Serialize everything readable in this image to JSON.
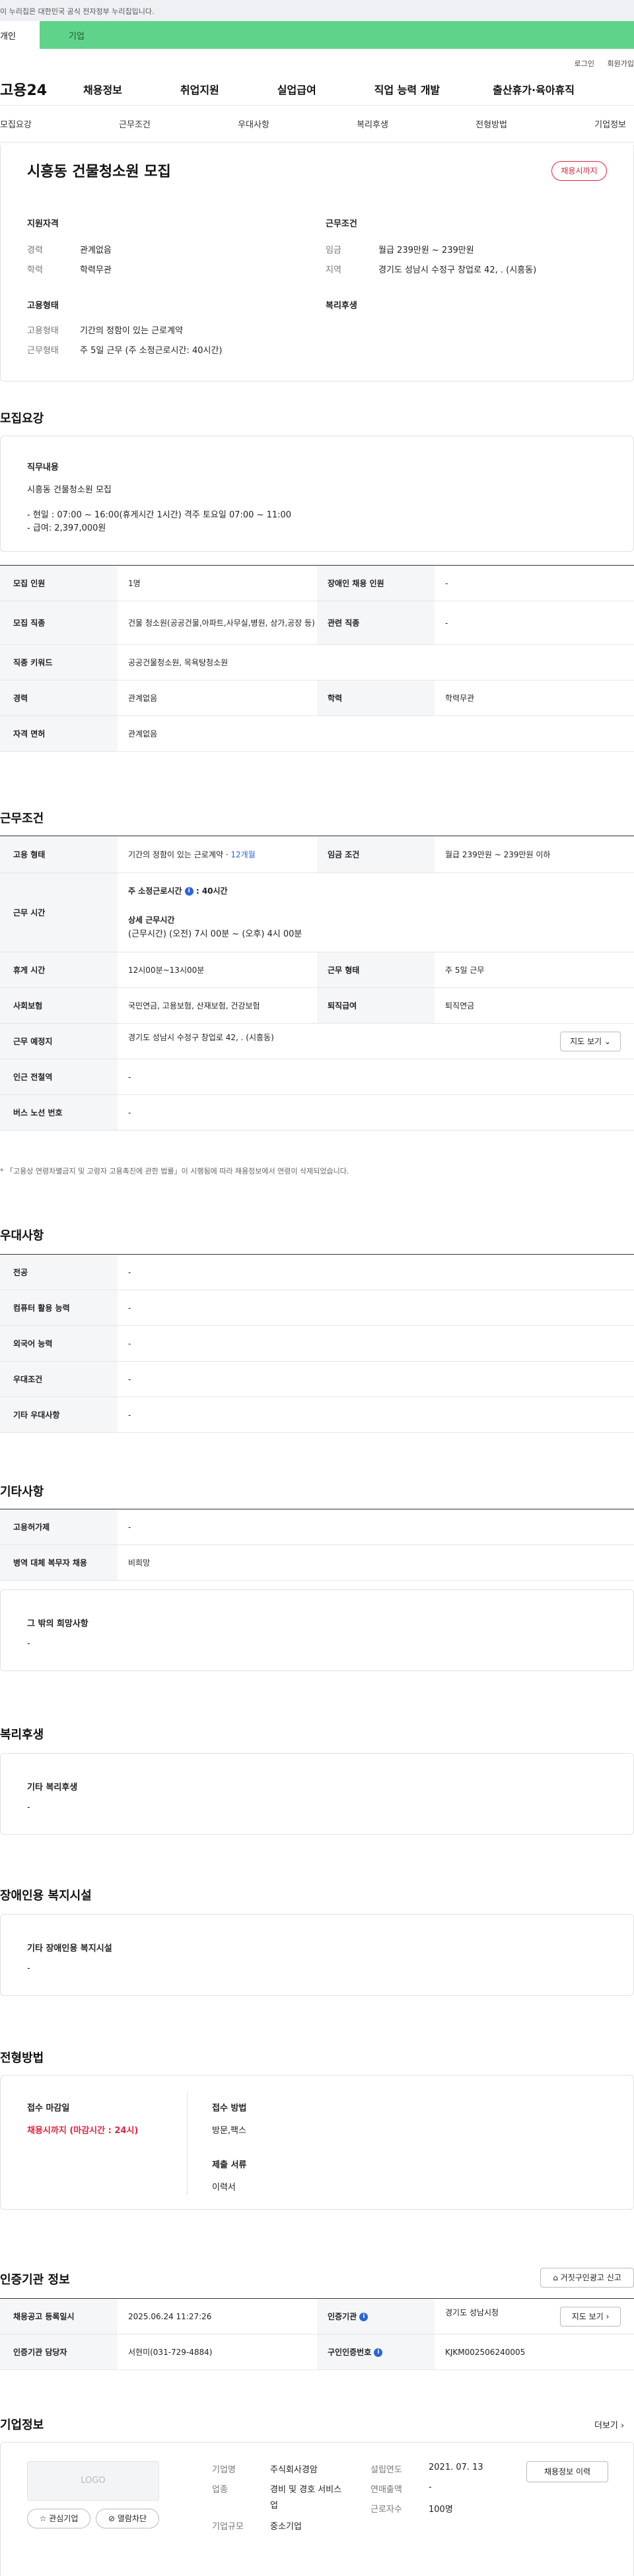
{
  "gov_banner": "이 누리집은 대한민국 공식 전자정부 누리집입니다.",
  "user_tabs": [
    "개인",
    "기업"
  ],
  "util_links": [
    "로그인",
    "회원가입"
  ],
  "brand": "고용24",
  "gnb": [
    "채용정보",
    "취업지원",
    "실업급여",
    "직업 능력 개발",
    "출산휴가·육아휴직"
  ],
  "subnav": [
    "모집요강",
    "근무조건",
    "우대사항",
    "복리후생",
    "전형방법",
    "기업정보"
  ],
  "summary": {
    "title": "시흥동 건물청소원 모집",
    "deadline_badge": "채용시까지",
    "qual_heading": "지원자격",
    "qual": [
      {
        "label": "경력",
        "value": "관계없음"
      },
      {
        "label": "학력",
        "value": "학력무관"
      }
    ],
    "work_heading": "근무조건",
    "work": [
      {
        "label": "임금",
        "value": "월급 239만원 ~ 239만원"
      },
      {
        "label": "지역",
        "value": "경기도 성남시 수정구 창업로 42, . (시흥동)"
      }
    ],
    "emp_heading": "고용형태",
    "emp": [
      {
        "label": "고용형태",
        "value": "기간의 정함이 있는 근로계약"
      },
      {
        "label": "근무형태",
        "value": "주 5일 근무 (주 소정근로시간: 40시간)"
      }
    ],
    "welfare_heading": "복리후생"
  },
  "recruit": {
    "heading": "모집요강",
    "duty_heading": "직무내용",
    "duty_text": "시흥동 건물청소원 모집",
    "duty_lines": [
      "- 현일 : 07:00 ~ 16:00(휴게시간 1시간) 격주 토요일 07:00 ~ 11:00",
      "- 급여: 2,397,000원"
    ],
    "rows": [
      {
        "l1": "모집 인원",
        "v1": "1명",
        "l2": "장애인 채용 인원",
        "v2": "-"
      },
      {
        "l1": "모집 직종",
        "v1": "건물 청소원(공공건물,아파트,사무실,병원, 상가,공장 등)",
        "l2": "관련 직종",
        "v2": "-"
      },
      {
        "l1": "직종 키워드",
        "v1": "공공건물청소원, 목욕탕청소원"
      },
      {
        "l1": "경력",
        "v1": "관계없음",
        "l2": "학력",
        "v2": "학력무관"
      },
      {
        "l1": "자격 면허",
        "v1": "관계없음"
      }
    ]
  },
  "work_cond": {
    "heading": "근무조건",
    "emp_type_label": "고용 형태",
    "emp_type_value": "기간의 정함이 있는 근로계약 · ",
    "emp_type_period": "12개월",
    "wage_label": "임금 조건",
    "wage_value": "월급 239만원 ~ 239만원 이하",
    "hours_label": "근무 시간",
    "hours_title": "주 소정근로시간",
    "hours_value": ": 40시간",
    "hours_detail_title": "상세 근무시간",
    "hours_detail": "(근무시간) (오전) 7시 00분 ~ (오후) 4시 00분",
    "break_label": "휴게 시간",
    "break_value": "12시00분~13시00분",
    "work_form_label": "근무 형태",
    "work_form_value": "주 5일 근무",
    "insurance_label": "사회보험",
    "insurance_value": "국민연금, 고용보험, 산재보험, 건강보험",
    "retire_label": "퇴직급여",
    "retire_value": "퇴직연금",
    "place_label": "근무 예정지",
    "place_value": "경기도 성남시 수정구 창업로 42, . (시흥동)",
    "map_button": "지도 보기",
    "subway_label": "인근 전철역",
    "subway_value": "-",
    "bus_label": "버스 노선 번호",
    "bus_value": "-",
    "notice": "* 「고용상 연령차별금지 및 고령자 고용촉진에 관한 법률」이 시행됨에 따라 채용정보에서 연령이 삭제되었습니다."
  },
  "preference": {
    "heading": "우대사항",
    "rows": [
      {
        "label": "전공",
        "value": "-"
      },
      {
        "label": "컴퓨터 활용 능력",
        "value": "-"
      },
      {
        "label": "외국어 능력",
        "value": "-"
      },
      {
        "label": "우대조건",
        "value": "-"
      },
      {
        "label": "기타 우대사항",
        "value": "-"
      }
    ]
  },
  "other": {
    "heading": "기타사항",
    "rows": [
      {
        "label": "고용허가제",
        "value": "-"
      },
      {
        "label": "병역 대체 복무자 채용",
        "value": "비희망"
      }
    ],
    "wish_heading": "그 밖의 희망사항",
    "wish_value": "-"
  },
  "welfare": {
    "heading": "복리후생",
    "box_heading": "기타 복리후생",
    "box_value": "-"
  },
  "disability": {
    "heading": "장애인용 복지시설",
    "box_heading": "기타 장애인용 복지시설",
    "box_value": "-"
  },
  "selection": {
    "heading": "전형방법",
    "deadline_heading": "접수 마감일",
    "deadline_value": "채용시까지 (마감시간 : 24시)",
    "method_heading": "접수 방법",
    "method_value": "방문,팩스",
    "docs_heading": "제출 서류",
    "docs_value": "이력서"
  },
  "agency": {
    "heading": "인증기관 정보",
    "report_button": "거짓구인광고 신고",
    "reg_label": "채용공고 등록일시",
    "reg_value": "2025.06.24 11:27:26",
    "agency_label": "인증기관",
    "agency_value": "경기도 성남시청",
    "map_button": "지도 보기",
    "staff_label": "인증기관 담당자",
    "staff_value": "서현미(031-729-4884)",
    "ad_no_label": "구인인증번호",
    "ad_no_value": "KJKM002506240005"
  },
  "company": {
    "heading": "기업정보",
    "more": "더보기",
    "logo": "LOGO",
    "fav_button": "관심기업",
    "block_button": "열람차단",
    "name_label": "기업명",
    "name_value": "주식회사경암",
    "industry_label": "업종",
    "industry_value": "경비 및 경호 서비스업",
    "size_label": "기업규모",
    "size_value": "중소기업",
    "founded_label": "설립연도",
    "founded_value": "2021. 07. 13",
    "sales_label": "연매출액",
    "sales_value": "-",
    "staff_label": "근로자수",
    "staff_value": "100명",
    "history_button": "채용정보 이력"
  }
}
